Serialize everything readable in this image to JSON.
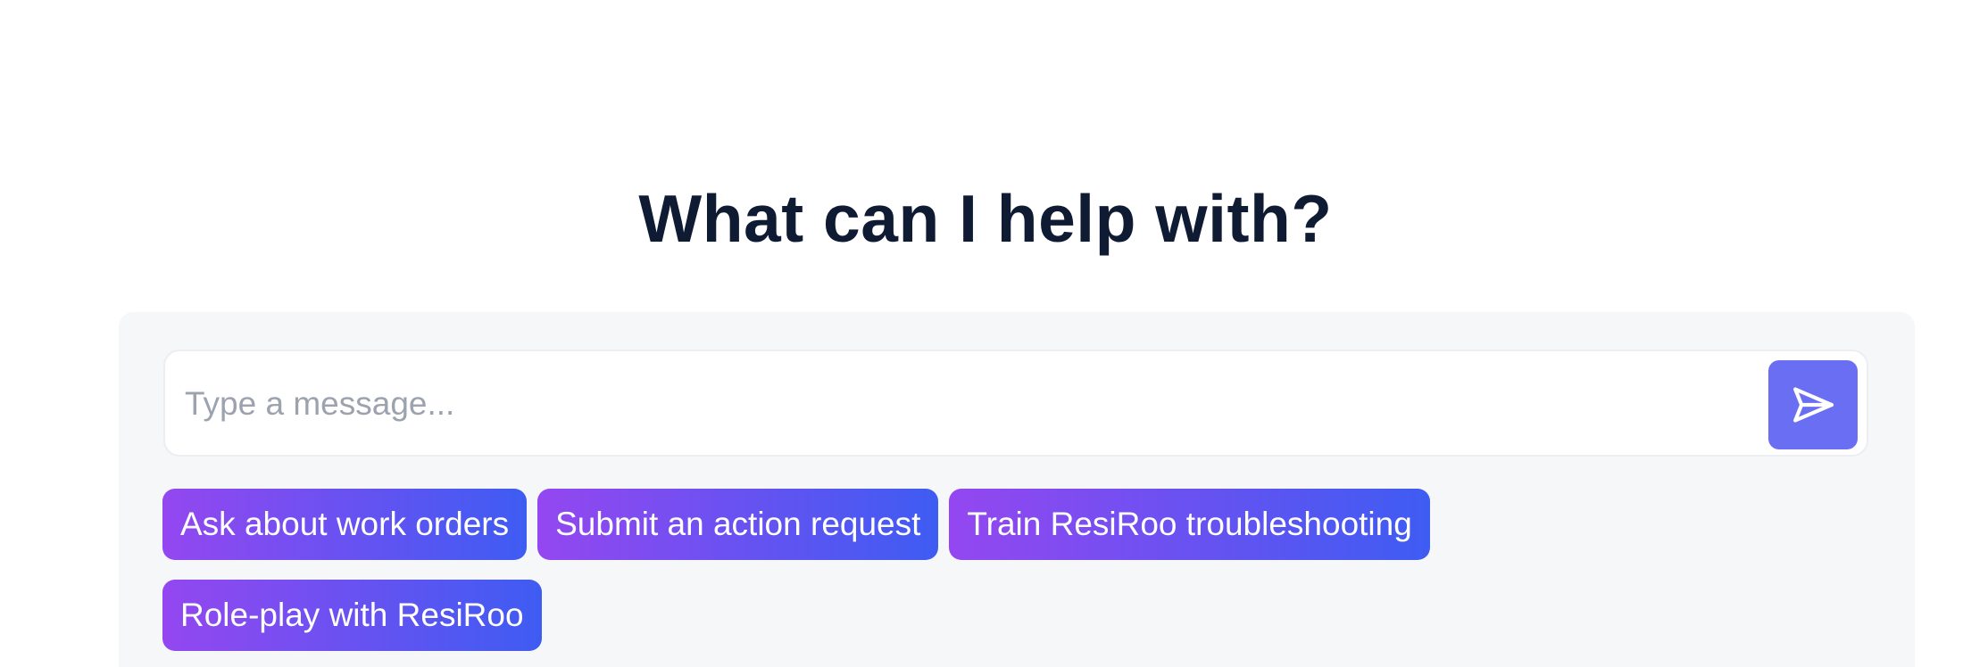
{
  "headline": "What can I help with?",
  "composer": {
    "placeholder": "Type a message...",
    "value": "",
    "send_icon": "send-icon"
  },
  "suggestions": [
    "Ask about work orders",
    "Submit an action request",
    "Train ResiRoo troubleshooting",
    "Role-play with ResiRoo"
  ],
  "colors": {
    "headline": "#0f1a33",
    "send_button": "#6a6ef2",
    "chip_gradient_start": "#9447f0",
    "chip_gradient_end": "#3e5cf2",
    "panel_background": "#f6f7f9"
  }
}
